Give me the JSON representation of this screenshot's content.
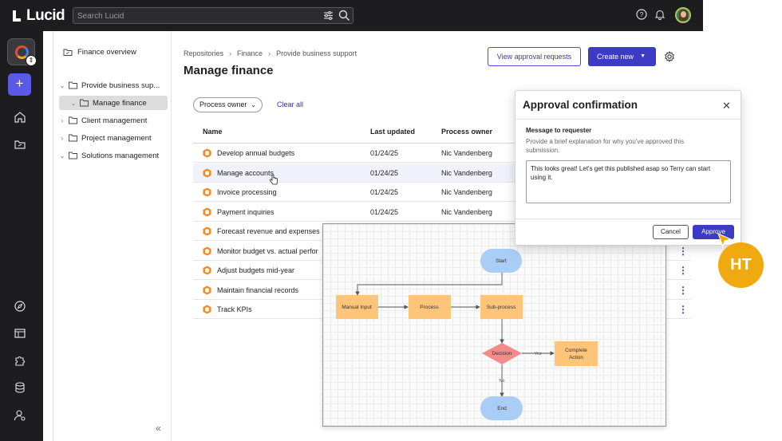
{
  "app": {
    "brand": "Lucid"
  },
  "topbar": {
    "search_placeholder": "Search Lucid",
    "icons": [
      "filter-sliders-icon",
      "search-icon",
      "help-icon",
      "bell-icon",
      "avatar"
    ]
  },
  "rail": {
    "icons": [
      "app-switcher",
      "plus-icon",
      "home-icon",
      "folder-icon",
      "compass-icon",
      "template-icon",
      "puzzle-icon",
      "database-icon",
      "user-settings-icon"
    ]
  },
  "sidebar": {
    "title": "Finance overview",
    "tree": [
      {
        "label": "Provide business sup...",
        "expanded": true
      },
      {
        "label": "Manage finance",
        "selected": true
      },
      {
        "label": "Client management",
        "expanded": false
      },
      {
        "label": "Project management",
        "expanded": false
      },
      {
        "label": "Solutions management",
        "expanded": true
      }
    ]
  },
  "breadcrumb": [
    "Repositories",
    "Finance",
    "Provide business support"
  ],
  "page": {
    "title": "Manage finance",
    "view_approval_label": "View approval requests",
    "create_new_label": "Create new"
  },
  "filters": {
    "chip_label": "Process owner",
    "clear_label": "Clear all"
  },
  "table": {
    "headers": [
      "Name",
      "Last updated",
      "Process owner"
    ],
    "rows": [
      {
        "name": "Develop annual budgets",
        "date": "01/24/25",
        "owner": "Nic Vandenberg"
      },
      {
        "name": "Manage accounts",
        "date": "01/24/25",
        "owner": "Nic Vandenberg"
      },
      {
        "name": "Invoice processing",
        "date": "01/24/25",
        "owner": "Nic Vandenberg"
      },
      {
        "name": "Payment inquiries",
        "date": "01/24/25",
        "owner": "Nic Vandenberg"
      },
      {
        "name": "Forecast revenue and expenses",
        "date": "",
        "owner": ""
      },
      {
        "name": "Monitor budget vs. actual perfor",
        "date": "",
        "owner": ""
      },
      {
        "name": "Adjust budgets mid-year",
        "date": "",
        "owner": ""
      },
      {
        "name": "Maintain financial records",
        "date": "",
        "owner": ""
      },
      {
        "name": "Track KPIs",
        "date": "",
        "owner": ""
      }
    ]
  },
  "flowchart": {
    "start": "Start",
    "manual_input": "Manual Input",
    "process": "Process",
    "sub_process": "Sub-process",
    "decision": "Decision",
    "yes": "Yes",
    "no": "No",
    "complete_1": "Complete",
    "complete_2": "Action",
    "end": "End",
    "colors": {
      "terminal": "#a9cdf5",
      "box": "#fdc57a",
      "decision": "#f58a8a"
    }
  },
  "dialog": {
    "title": "Approval confirmation",
    "message_label": "Message to requester",
    "help_text": "Provide a brief explanation for why you've approved this submission.",
    "message_value": "This looks great! Let's get this published asap so Terry can start using it.",
    "cancel_label": "Cancel",
    "approve_label": "Approve"
  },
  "collaborator": {
    "initials": "HT",
    "color": "#f0a90f"
  },
  "colors": {
    "accent": "#3b3bc4",
    "topbar": "#1d1d1f"
  }
}
